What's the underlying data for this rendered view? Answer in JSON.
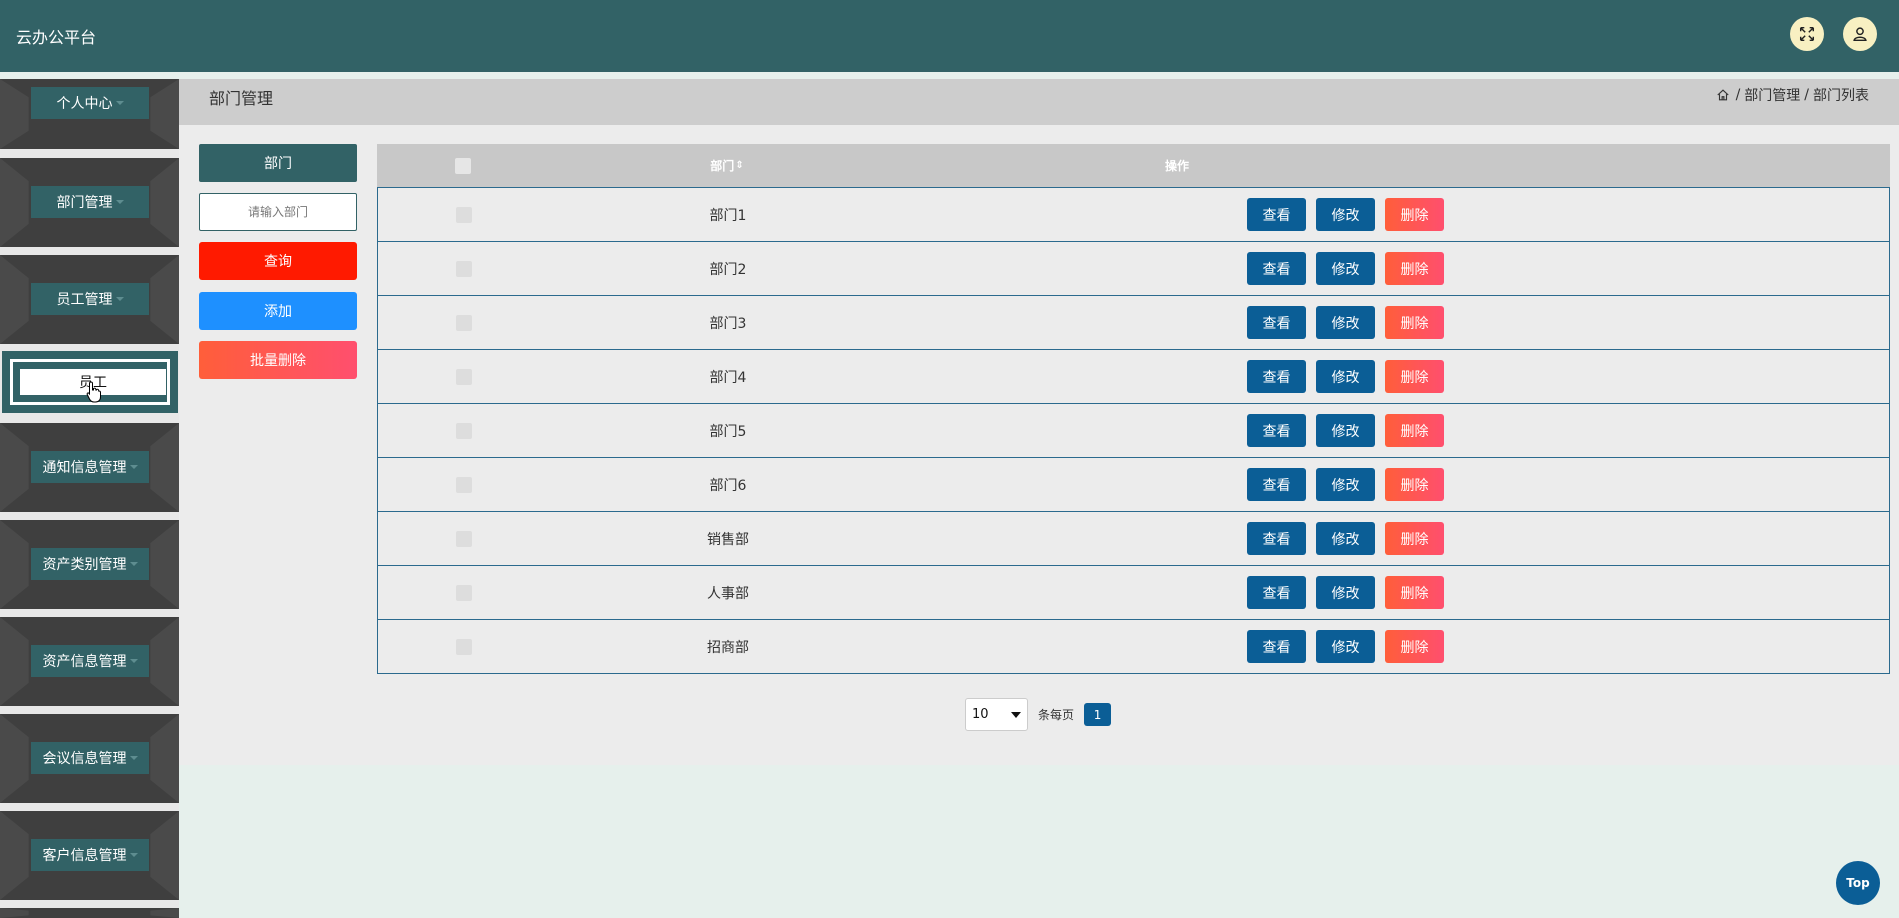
{
  "header": {
    "app_title": "云办公平台",
    "icons": [
      "fullscreen-icon",
      "user-icon"
    ]
  },
  "sidebar": {
    "items": [
      {
        "label": "个人中心"
      },
      {
        "label": "部门管理"
      },
      {
        "label": "员工管理"
      },
      {
        "label": "通知信息管理"
      },
      {
        "label": "资产类别管理"
      },
      {
        "label": "资产信息管理"
      },
      {
        "label": "会议信息管理"
      },
      {
        "label": "客户信息管理"
      }
    ],
    "active_sub_item": "员工"
  },
  "page": {
    "title": "部门管理",
    "breadcrumb": [
      "部门管理",
      "部门列表"
    ]
  },
  "filter": {
    "label": "部门",
    "placeholder": "请输入部门",
    "query_button": "查询",
    "add_button": "添加",
    "batch_delete_button": "批量删除"
  },
  "table": {
    "columns": [
      "部门",
      "操作"
    ],
    "sort_glyph": "⇕",
    "rows": [
      {
        "name": "部门1"
      },
      {
        "name": "部门2"
      },
      {
        "name": "部门3"
      },
      {
        "name": "部门4"
      },
      {
        "name": "部门5"
      },
      {
        "name": "部门6"
      },
      {
        "name": "销售部"
      },
      {
        "name": "人事部"
      },
      {
        "name": "招商部"
      }
    ],
    "actions": {
      "view": "查看",
      "edit": "修改",
      "delete": "删除"
    }
  },
  "pager": {
    "page_size": "10",
    "per_page_label": "条每页",
    "current_page": "1"
  },
  "back_to_top": "Top",
  "colors": {
    "header": "#326266",
    "primary_btn": "#0b5e96",
    "query_btn": "#ff1a00",
    "add_btn": "#1e90ff",
    "delete_btn": "#ff5e3a"
  }
}
